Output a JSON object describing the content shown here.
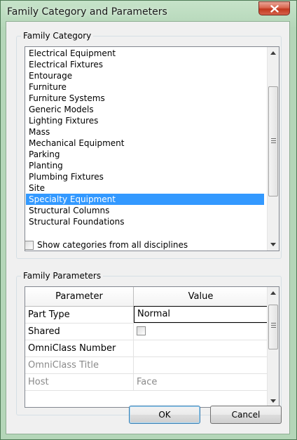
{
  "window": {
    "title": "Family Category and Parameters"
  },
  "family_category": {
    "label": "Family Category",
    "items": [
      "Electrical Equipment",
      "Electrical Fixtures",
      "Entourage",
      "Furniture",
      "Furniture Systems",
      "Generic Models",
      "Lighting Fixtures",
      "Mass",
      "Mechanical Equipment",
      "Parking",
      "Planting",
      "Plumbing Fixtures",
      "Site",
      "Specialty Equipment",
      "Structural Columns",
      "Structural Foundations"
    ],
    "selected_item": "Specialty Equipment",
    "show_all_disciplines_label": "Show categories from all disciplines",
    "show_all_disciplines_checked": false
  },
  "family_parameters": {
    "label": "Family Parameters",
    "columns": {
      "parameter": "Parameter",
      "value": "Value"
    },
    "rows": [
      {
        "parameter": "Part Type",
        "value": "Normal"
      },
      {
        "parameter": "Shared",
        "value": ""
      },
      {
        "parameter": "OmniClass Number",
        "value": ""
      },
      {
        "parameter": "OmniClass Title",
        "value": ""
      },
      {
        "parameter": "Host",
        "value": "Face"
      }
    ],
    "shared_checked": false
  },
  "buttons": {
    "ok": "OK",
    "cancel": "Cancel"
  }
}
